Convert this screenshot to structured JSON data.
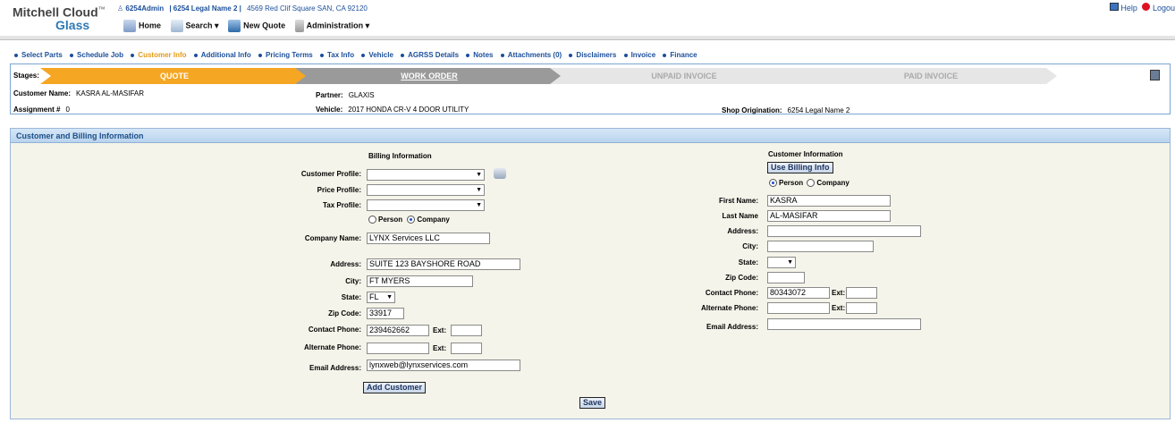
{
  "app": {
    "logo_line1": "Mitchell Cloud",
    "tm": "™",
    "logo_line2": "Glass"
  },
  "header": {
    "user": "6254Admin",
    "shop": "| 6254 Legal Name 2 |",
    "address": "4569 Red Clif Square SAN, CA 92120",
    "help": "Help",
    "logout": "Logou"
  },
  "mainnav": {
    "home": "Home",
    "search": "Search ▾",
    "new_quote": "New Quote",
    "admin": "Administration ▾"
  },
  "subnav": [
    "Select Parts",
    "Schedule Job",
    "Customer Info",
    "Additional Info",
    "Pricing Terms",
    "Tax Info",
    "Vehicle",
    "AGRSS Details",
    "Notes",
    "Attachments (0)",
    "Disclaimers",
    "Invoice",
    "Finance"
  ],
  "stages": {
    "label": "Stages:",
    "items": [
      "QUOTE",
      "WORK ORDER",
      "UNPAID INVOICE",
      "PAID INVOICE"
    ],
    "colors": {
      "quote": "#f5a623",
      "work_order": "#999999",
      "inactive": "#e6e6e6"
    }
  },
  "summary": {
    "customer_name_label": "Customer Name:",
    "customer_name": "KASRA AL-MASIFAR",
    "assignment_label": "Assignment #",
    "assignment": "0",
    "partner_label": "Partner:",
    "partner": "GLAXIS",
    "vehicle_label": "Vehicle:",
    "vehicle": "2017 HONDA CR-V 4 DOOR UTILITY",
    "shop_origination_label": "Shop Origination:",
    "shop_origination": "6254 Legal Name 2"
  },
  "panel": {
    "title": "Customer and Billing Information"
  },
  "billing": {
    "title": "Billing Information",
    "customer_profile_label": "Customer Profile:",
    "price_profile_label": "Price Profile:",
    "tax_profile_label": "Tax Profile:",
    "person_label": "Person",
    "company_label": "Company",
    "company_name_label": "Company Name:",
    "company_name": "LYNX Services LLC",
    "address_label": "Address:",
    "address": "SUITE 123 BAYSHORE ROAD",
    "city_label": "City:",
    "city": "FT MYERS",
    "state_label": "State:",
    "state": "FL",
    "zip_label": "Zip Code:",
    "zip": "33917",
    "contact_phone_label": "Contact Phone:",
    "contact_phone": "239462662",
    "ext_label": "Ext:",
    "alt_phone_label": "Alternate Phone:",
    "email_label": "Email Address:",
    "email": "lynxweb@lynxservices.com",
    "add_customer": "Add Customer"
  },
  "customer": {
    "title": "Customer Information",
    "use_billing": "Use Billing Info",
    "person_label": "Person",
    "company_label": "Company",
    "first_name_label": "First Name:",
    "first_name": "KASRA",
    "last_name_label": "Last Name",
    "last_name": "AL-MASIFAR",
    "address_label": "Address:",
    "city_label": "City:",
    "state_label": "State:",
    "zip_label": "Zip Code:",
    "contact_phone_label": "Contact Phone:",
    "contact_phone": "80343072",
    "ext_label": "Ext:",
    "alt_phone_label": "Alternate Phone:",
    "email_label": "Email Address:"
  },
  "save": "Save"
}
